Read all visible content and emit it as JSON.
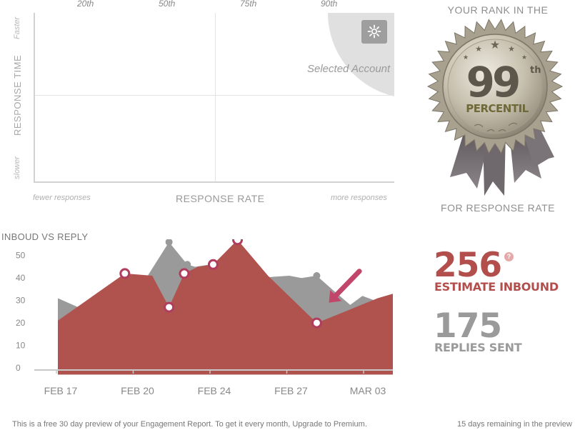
{
  "quadrant": {
    "percentiles": [
      "20th",
      "50th",
      "75th",
      "90th"
    ],
    "y_label": "RESPONSE TIME",
    "y_top": "Faster",
    "y_bottom": "slower",
    "x_label": "RESPONSE RATE",
    "x_left": "fewer responses",
    "x_right": "more responses",
    "selected_label": "Selected Account",
    "button_icon": "gear-icon"
  },
  "rank": {
    "title": "YOUR RANK IN THE",
    "value": "99",
    "suffix": "th",
    "unit": "PERCENTIL",
    "subtitle": "FOR RESPONSE RATE"
  },
  "chart_data": {
    "type": "area",
    "title": "INBOUD VS REPLY",
    "x_labels": [
      "FEB 17",
      "FEB 20",
      "FEB 24",
      "FEB 27",
      "MAR 03"
    ],
    "y_ticks": [
      0,
      10,
      20,
      30,
      40,
      50
    ],
    "ylim": [
      0,
      55
    ],
    "grid": false,
    "colors": {
      "inbound": "#9a9a9a",
      "reply": "#b0524e",
      "marker_inbound": "#999999",
      "marker_reply": "#b03d5e",
      "arrow": "#c2466a"
    },
    "series": [
      {
        "key": "inbound",
        "points": [
          [
            0,
            31
          ],
          [
            1,
            25
          ],
          [
            2,
            40
          ],
          [
            2.95,
            41
          ],
          [
            3.65,
            56
          ],
          [
            4.25,
            46
          ],
          [
            4.5,
            45
          ],
          [
            5,
            46
          ],
          [
            5.5,
            44
          ],
          [
            6,
            42
          ],
          [
            6.5,
            40
          ],
          [
            7.6,
            41
          ],
          [
            8,
            40
          ],
          [
            8.5,
            41
          ],
          [
            9,
            35
          ],
          [
            9.6,
            28
          ],
          [
            10,
            32
          ],
          [
            10.6,
            29
          ],
          [
            11,
            20
          ]
        ],
        "markers": [
          [
            3.65,
            56
          ],
          [
            4.25,
            46
          ],
          [
            8.5,
            41
          ]
        ]
      },
      {
        "key": "reply",
        "points": [
          [
            0,
            21
          ],
          [
            2.2,
            42
          ],
          [
            3.1,
            41
          ],
          [
            3.65,
            27
          ],
          [
            4.15,
            42
          ],
          [
            4.6,
            45
          ],
          [
            5.1,
            46
          ],
          [
            5.9,
            57
          ],
          [
            6.9,
            41
          ],
          [
            8.5,
            20
          ],
          [
            9.6,
            26
          ],
          [
            10.5,
            31
          ],
          [
            11,
            33
          ]
        ],
        "markers": [
          [
            2.2,
            42
          ],
          [
            3.65,
            27
          ],
          [
            4.15,
            42
          ],
          [
            5.1,
            46
          ],
          [
            5.9,
            57
          ],
          [
            8.5,
            20
          ]
        ]
      }
    ],
    "annotation": {
      "type": "arrow",
      "from": [
        9.9,
        43
      ],
      "to": [
        8.9,
        29
      ]
    }
  },
  "stats": {
    "inbound_value": "256",
    "inbound_label": "ESTIMATE INBOUND",
    "inbound_info": "?",
    "inbound_color": "#b24f4c",
    "replies_value": "175",
    "replies_label": "REPLIES SENT",
    "replies_color": "#9a9a9a"
  },
  "footer": {
    "left": "This is a free 30 day preview of your Engagement Report. To get it every month, Upgrade to Premium.",
    "right": "15 days remaining in the preview"
  }
}
